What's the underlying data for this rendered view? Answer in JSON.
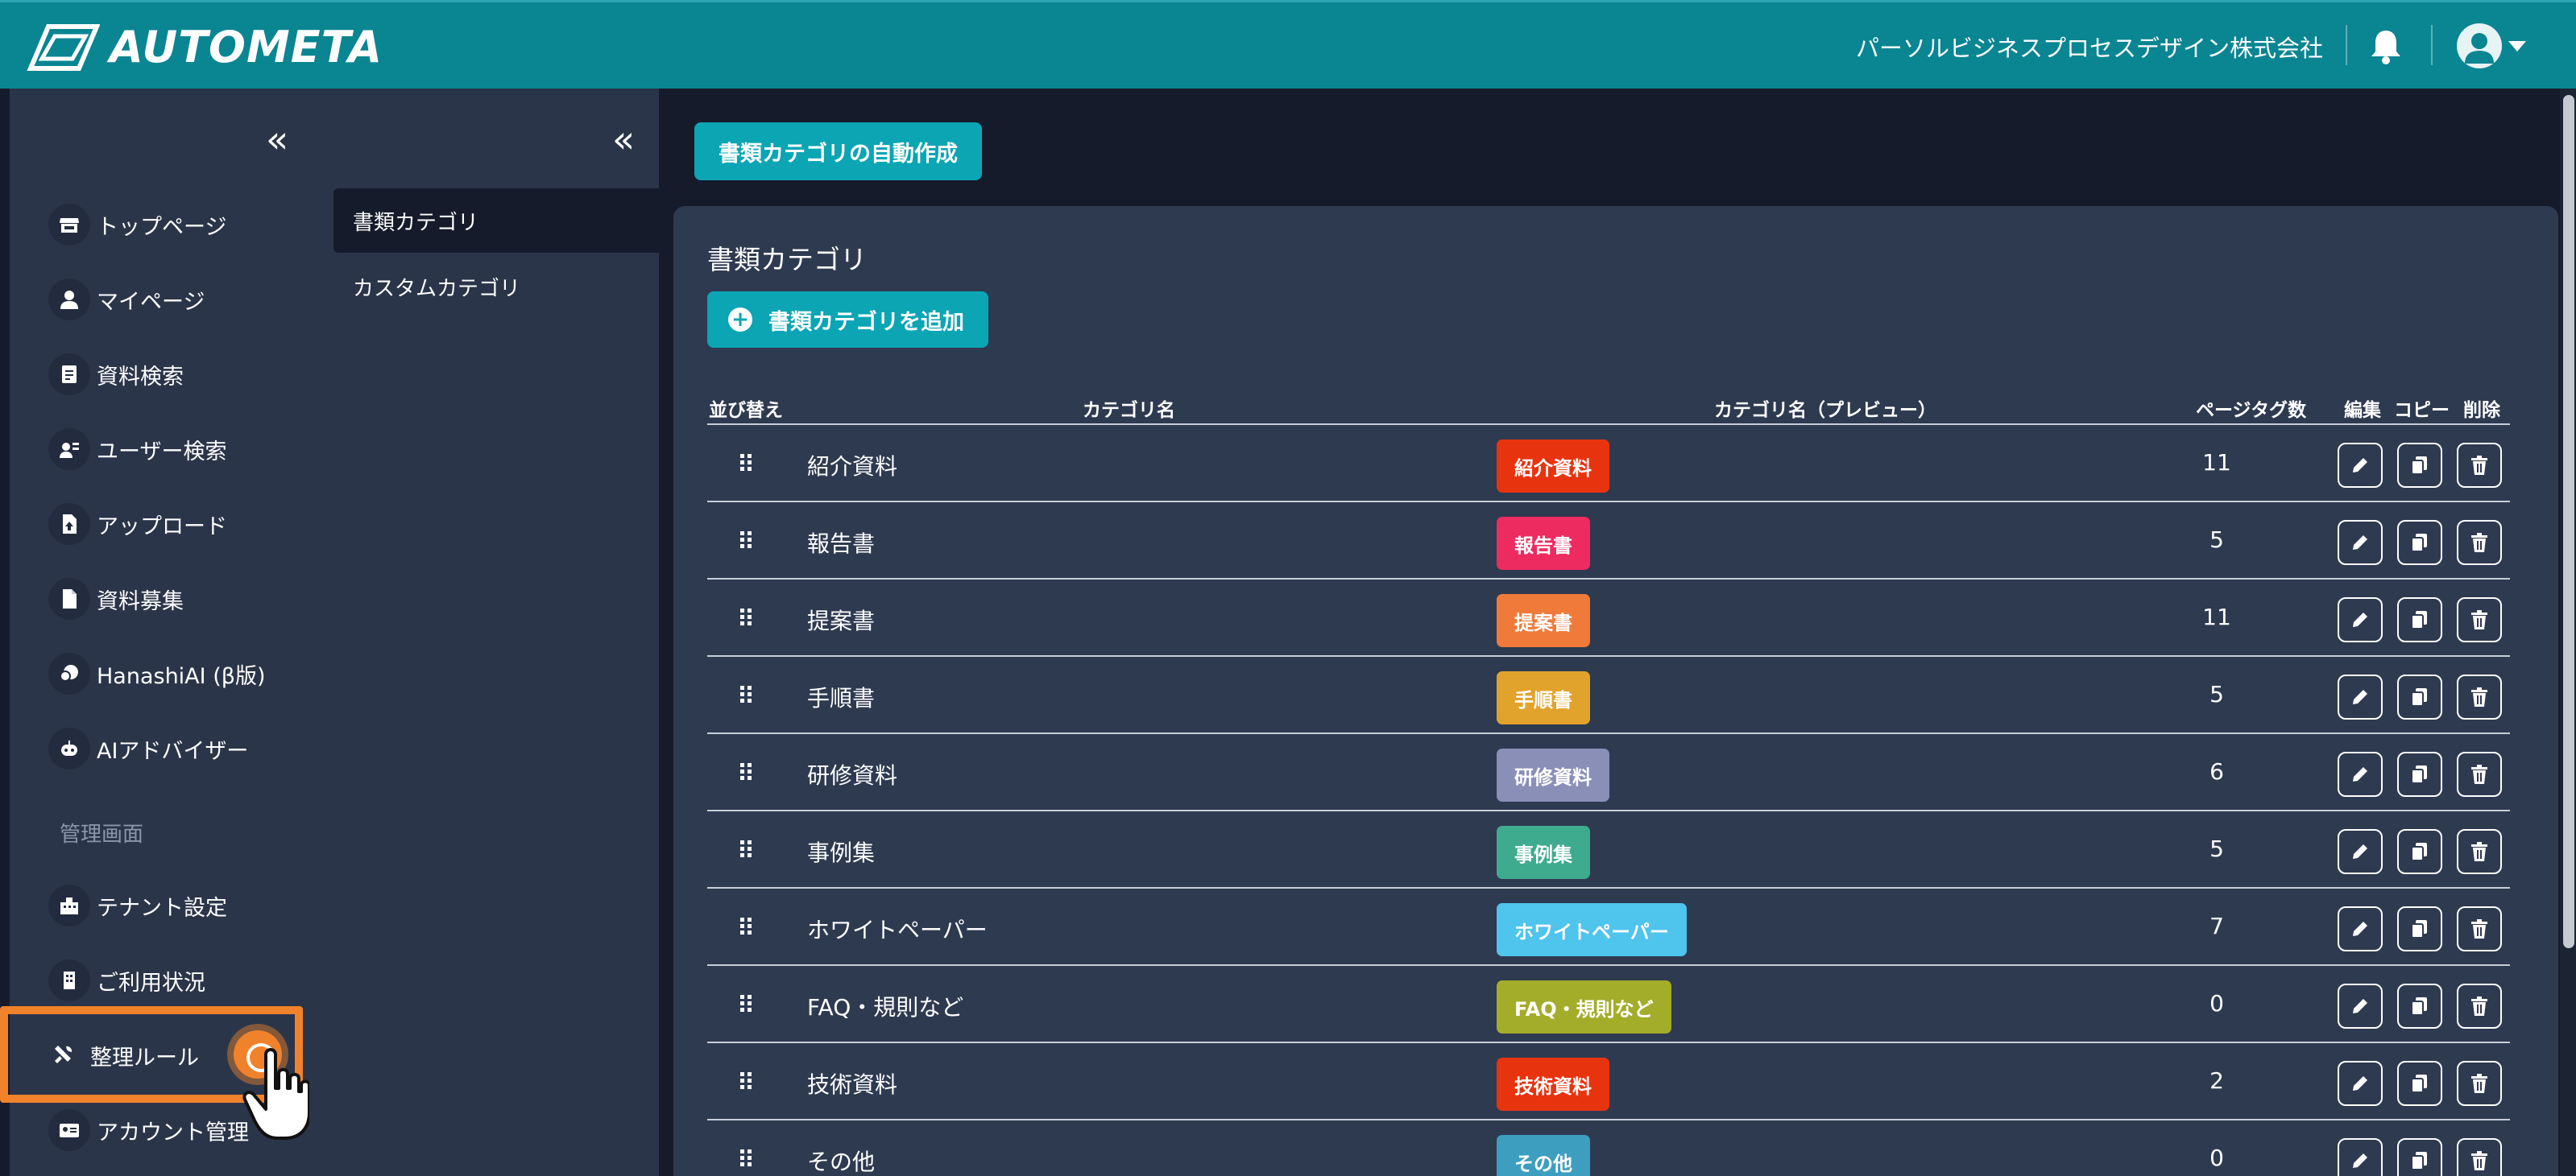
{
  "header": {
    "logo_text": "AUTOMETA",
    "company": "パーソルビジネスプロセスデザイン株式会社"
  },
  "sidebar": {
    "collapse_glyph": "«",
    "items": [
      {
        "label": "トップページ",
        "icon": "store-icon"
      },
      {
        "label": "マイページ",
        "icon": "person-icon"
      },
      {
        "label": "資料検索",
        "icon": "document-search-icon"
      },
      {
        "label": "ユーザー検索",
        "icon": "user-search-icon"
      },
      {
        "label": "アップロード",
        "icon": "file-upload-icon"
      },
      {
        "label": "資料募集",
        "icon": "file-icon"
      },
      {
        "label": "HanashiAI (β版)",
        "icon": "chat-bubble-icon"
      },
      {
        "label": "AIアドバイザー",
        "icon": "robot-icon"
      }
    ],
    "section_label": "管理画面",
    "admin_items": [
      {
        "label": "テナント設定",
        "icon": "building-icon"
      },
      {
        "label": "ご利用状況",
        "icon": "office-icon"
      },
      {
        "label": "整理ルール",
        "icon": "tools-icon",
        "active": true
      },
      {
        "label": "アカウント管理",
        "icon": "id-card-icon"
      }
    ]
  },
  "subnav": {
    "collapse_glyph": "«",
    "items": [
      {
        "label": "書類カテゴリ",
        "active": true
      },
      {
        "label": "カスタムカテゴリ",
        "active": false
      }
    ]
  },
  "main": {
    "auto_create_label": "書類カテゴリの自動作成",
    "card_title": "書類カテゴリ",
    "add_label": "書類カテゴリを追加",
    "columns": {
      "sort": "並び替え",
      "name": "カテゴリ名",
      "preview": "カテゴリ名（プレビュー）",
      "tag_count": "ページタグ数",
      "edit": "編集",
      "copy": "コピー",
      "delete": "削除"
    },
    "rows": [
      {
        "name": "紹介資料",
        "preview": "紹介資料",
        "count": "11",
        "color": "#e8330f"
      },
      {
        "name": "報告書",
        "preview": "報告書",
        "count": "5",
        "color": "#ee2b60"
      },
      {
        "name": "提案書",
        "preview": "提案書",
        "count": "11",
        "color": "#ef7a3a"
      },
      {
        "name": "手順書",
        "preview": "手順書",
        "count": "5",
        "color": "#e2a32c"
      },
      {
        "name": "研修資料",
        "preview": "研修資料",
        "count": "6",
        "color": "#8a8fb8"
      },
      {
        "name": "事例集",
        "preview": "事例集",
        "count": "5",
        "color": "#3fab8e"
      },
      {
        "name": "ホワイトペーパー",
        "preview": "ホワイトペーパー",
        "count": "7",
        "color": "#4fc4ec"
      },
      {
        "name": "FAQ・規則など",
        "preview": "FAQ・規則など",
        "count": "0",
        "color": "#a3ad2a"
      },
      {
        "name": "技術資料",
        "preview": "技術資料",
        "count": "2",
        "color": "#e8330f"
      },
      {
        "name": "その他",
        "preview": "その他",
        "count": "0",
        "color": "#3d9ec0"
      }
    ]
  },
  "colors": {
    "header": "#0a8592",
    "accent": "#0ba5b4",
    "highlight": "#f0822b",
    "sidebar": "#2b3549",
    "card": "#2e3a50"
  }
}
